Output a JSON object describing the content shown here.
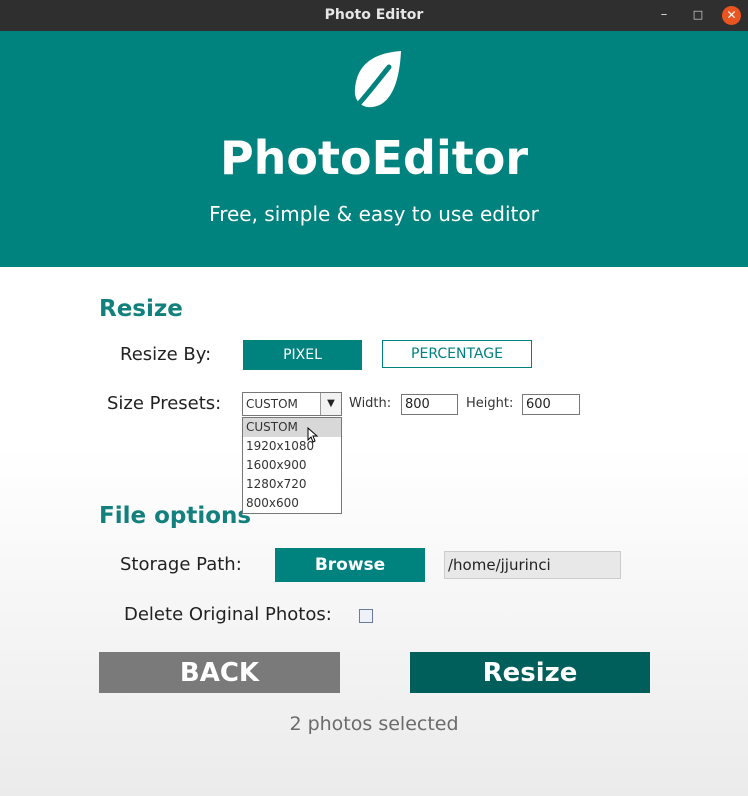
{
  "window": {
    "title": "Photo Editor",
    "min_icon": "–",
    "max_icon": "□",
    "close_icon": "✕"
  },
  "header": {
    "brand": "PhotoEditor",
    "tagline": "Free, simple & easy to use editor",
    "leaf_icon": "leaf-icon"
  },
  "resize": {
    "section_title": "Resize",
    "resize_by_label": "Resize By:",
    "pixel_label": "PIXEL",
    "percentage_label": "PERCENTAGE",
    "presets_label": "Size Presets:",
    "selected_preset": "CUSTOM",
    "preset_options": [
      "CUSTOM",
      "1920x1080",
      "1600x900",
      "1280x720",
      "800x600"
    ],
    "width_label": "Width:",
    "width_value": "800",
    "height_label": "Height:",
    "height_value": "600"
  },
  "file_options": {
    "section_title": "File options",
    "storage_label": "Storage Path:",
    "browse_label": "Browse",
    "path_value": "/home/jjurinci",
    "delete_label": "Delete Original Photos:",
    "delete_checked": false
  },
  "actions": {
    "back_label": "BACK",
    "resize_label": "Resize"
  },
  "status": "2 photos selected",
  "colors": {
    "teal": "#00827f",
    "dark_teal": "#005f5b",
    "grey_button": "#7a7a7a",
    "close": "#e95420"
  }
}
